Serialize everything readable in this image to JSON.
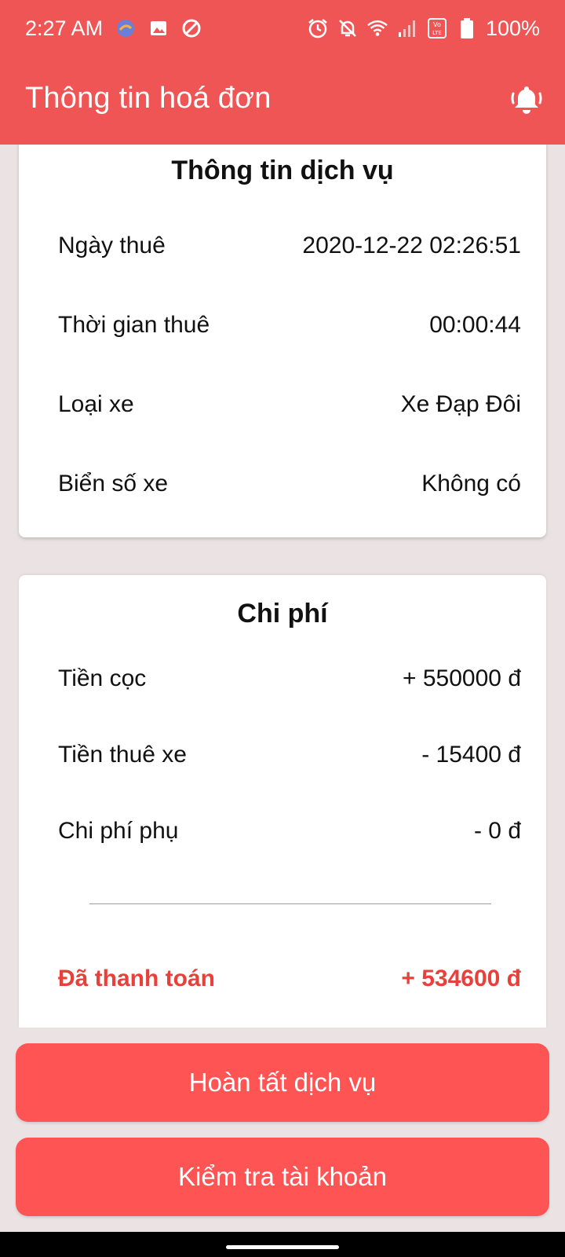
{
  "status_bar": {
    "time": "2:27 AM",
    "battery": "100%",
    "left_icons": [
      "app-notification-icon",
      "image-icon",
      "data-saver-icon"
    ],
    "right_icons": [
      "alarm-icon",
      "notifications-off-icon",
      "wifi-icon",
      "signal-icon",
      "volte-icon",
      "battery-icon"
    ]
  },
  "header": {
    "title": "Thông tin hoá đơn",
    "bell_icon": "bell-ringing-icon"
  },
  "service_card": {
    "title": "Thông tin dịch vụ",
    "rows": [
      {
        "label": "Ngày thuê",
        "value": "2020-12-22 02:26:51"
      },
      {
        "label": "Thời gian thuê",
        "value": "00:00:44"
      },
      {
        "label": "Loại xe",
        "value": "Xe Đạp Đôi"
      },
      {
        "label": "Biển số xe",
        "value": "Không có"
      }
    ]
  },
  "cost_card": {
    "title": "Chi phí",
    "rows": [
      {
        "label": "Tiền cọc",
        "value": "+ 550000 đ"
      },
      {
        "label": "Tiền thuê xe",
        "value": "- 15400 đ"
      },
      {
        "label": "Chi phí phụ",
        "value": "- 0 đ"
      }
    ],
    "total": {
      "label": "Đã thanh toán",
      "value": "+ 534600 đ"
    }
  },
  "buttons": {
    "complete": "Hoàn tất dịch vụ",
    "check_account": "Kiểm tra tài khoản"
  },
  "colors": {
    "header": "#ef5555",
    "button": "#ff5454",
    "total_text": "#e8403a",
    "background": "#ebe3e3"
  }
}
